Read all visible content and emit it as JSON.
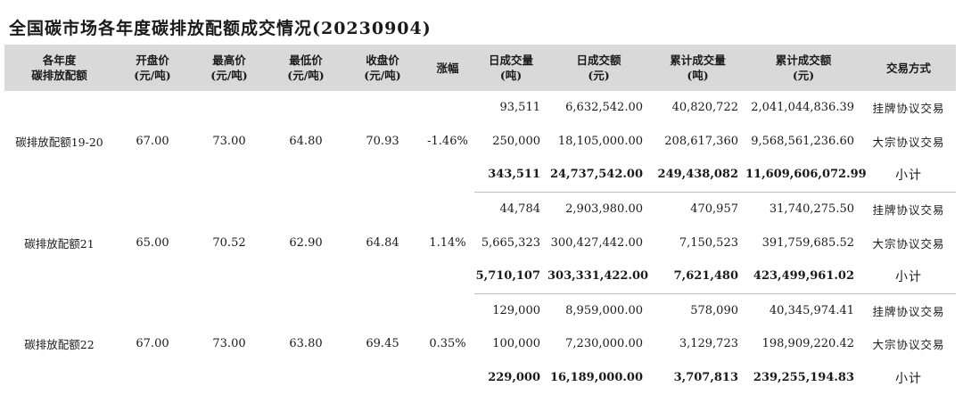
{
  "title": "全国碳市场各年度碳排放配额成交情况(20230904)",
  "headers": [
    [
      "各年度",
      "碳排放配额"
    ],
    [
      "开盘价",
      "(元/吨)"
    ],
    [
      "最高价",
      "(元/吨)"
    ],
    [
      "最低价",
      "(元/吨)"
    ],
    [
      "收盘价",
      "(元/吨)"
    ],
    [
      "涨幅"
    ],
    [
      "日成交量",
      "(吨)"
    ],
    [
      "日成交额",
      "(元)"
    ],
    [
      "累计成交量",
      "(吨)"
    ],
    [
      "累计成交额",
      "(元)"
    ],
    [
      "交易方式"
    ]
  ],
  "groups": [
    {
      "name": "碳排放配额19-20",
      "open": "67.00",
      "high": "73.00",
      "low": "64.80",
      "close": "70.93",
      "change": "-1.46%",
      "rows": [
        {
          "vol": "93,511",
          "amt": "6,632,542.00",
          "cum_vol": "40,820,722",
          "cum_amt": "2,041,044,836.39",
          "mode": "挂牌协议交易"
        },
        {
          "vol": "250,000",
          "amt": "18,105,000.00",
          "cum_vol": "208,617,360",
          "cum_amt": "9,568,561,236.60",
          "mode": "大宗协议交易"
        },
        {
          "vol": "343,511",
          "amt": "24,737,542.00",
          "cum_vol": "249,438,082",
          "cum_amt": "11,609,606,072.99",
          "mode": "小计"
        }
      ]
    },
    {
      "name": "碳排放配额21",
      "open": "65.00",
      "high": "70.52",
      "low": "62.90",
      "close": "64.84",
      "change": "1.14%",
      "rows": [
        {
          "vol": "44,784",
          "amt": "2,903,980.00",
          "cum_vol": "470,957",
          "cum_amt": "31,740,275.50",
          "mode": "挂牌协议交易"
        },
        {
          "vol": "5,665,323",
          "amt": "300,427,442.00",
          "cum_vol": "7,150,523",
          "cum_amt": "391,759,685.52",
          "mode": "大宗协议交易"
        },
        {
          "vol": "5,710,107",
          "amt": "303,331,422.00",
          "cum_vol": "7,621,480",
          "cum_amt": "423,499,961.02",
          "mode": "小计"
        }
      ]
    },
    {
      "name": "碳排放配额22",
      "open": "67.00",
      "high": "73.00",
      "low": "63.80",
      "close": "69.45",
      "change": "0.35%",
      "rows": [
        {
          "vol": "129,000",
          "amt": "8,959,000.00",
          "cum_vol": "578,090",
          "cum_amt": "40,345,974.41",
          "mode": "挂牌协议交易"
        },
        {
          "vol": "100,000",
          "amt": "7,230,000.00",
          "cum_vol": "3,129,723",
          "cum_amt": "198,909,220.42",
          "mode": "大宗协议交易"
        },
        {
          "vol": "229,000",
          "amt": "16,189,000.00",
          "cum_vol": "3,707,813",
          "cum_amt": "239,255,194.83",
          "mode": "小计"
        }
      ]
    }
  ]
}
